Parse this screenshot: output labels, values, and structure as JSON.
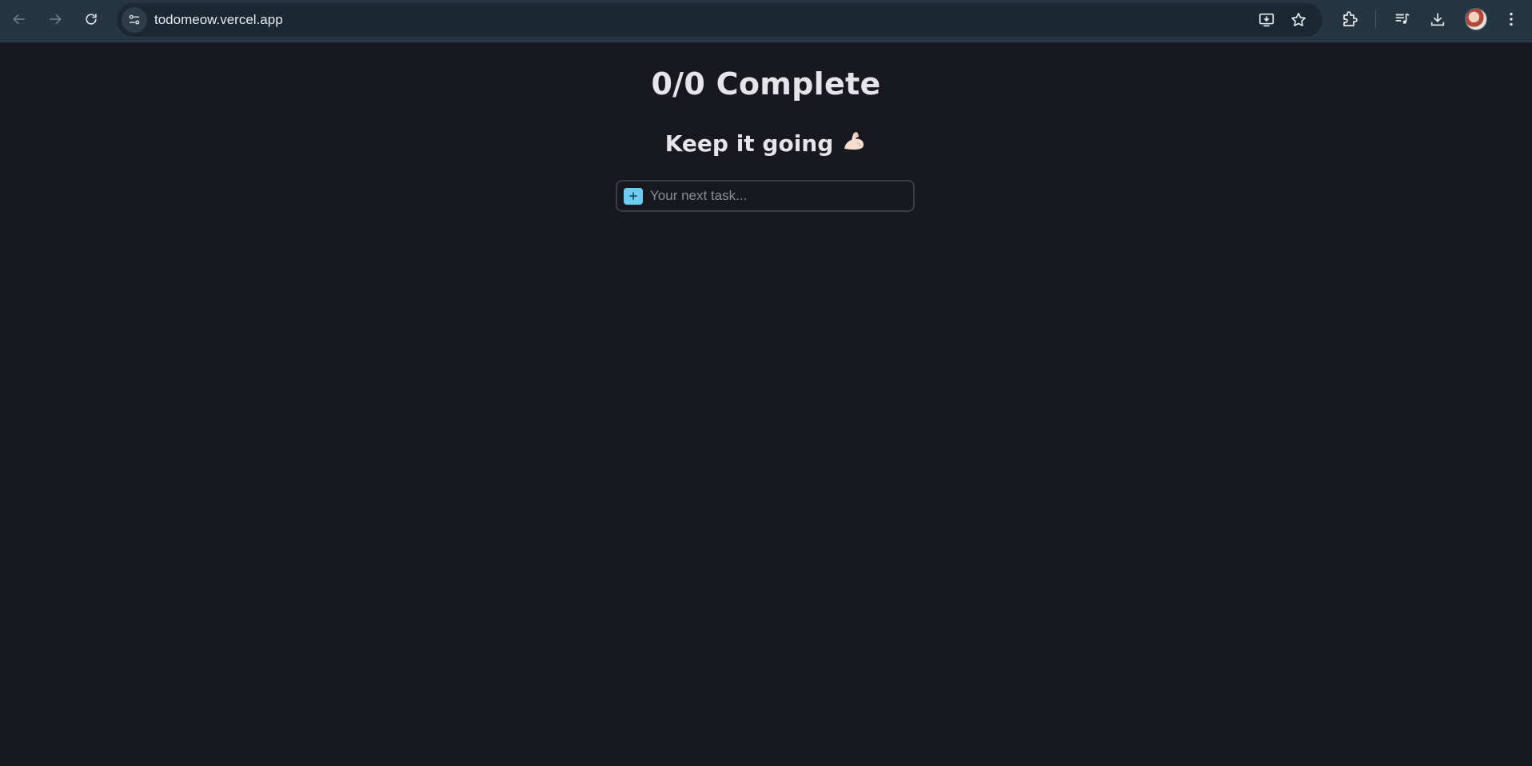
{
  "browser": {
    "url": "todomeow.vercel.app",
    "icons": {
      "back": "arrow-left-icon",
      "forward": "arrow-right-icon",
      "reload": "reload-icon",
      "site_info": "tune-icon",
      "install": "install-app-icon",
      "bookmark": "star-icon",
      "extensions": "puzzle-icon",
      "media": "media-playlist-icon",
      "downloads": "download-icon",
      "profile": "avatar",
      "menu": "kebab-menu-icon"
    }
  },
  "app": {
    "title": "0/0 Complete",
    "subtitle": "Keep it going",
    "subtitle_emoji": "flexed-biceps-icon",
    "task_input": {
      "placeholder": "Your next task...",
      "value": "",
      "add_label": "+"
    }
  },
  "colors": {
    "page_background": "#181820",
    "chrome_background": "#253542",
    "omnibox_background": "#1b2833",
    "accent": "#6ccdf3",
    "text": "#e6e4e9"
  }
}
